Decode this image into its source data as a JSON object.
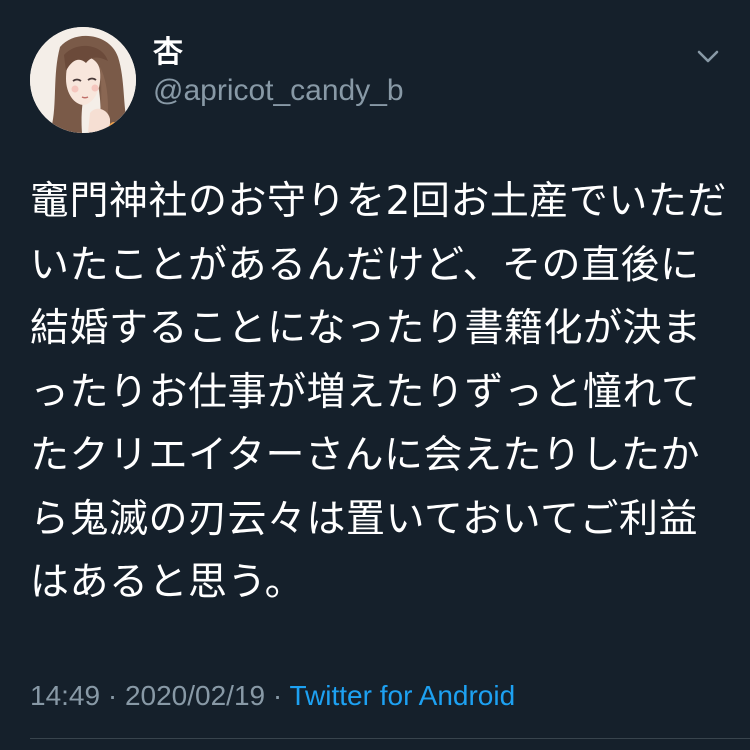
{
  "user": {
    "display_name": "杏",
    "handle": "@apricot_candy_b"
  },
  "tweet": {
    "text": "竈門神社のお守りを2回お土産でいただいたことがあるんだけど、その直後に結婚することになったり書籍化が決まったりお仕事が増えたりずっと憧れてたクリエイターさんに会えたりしたから鬼滅の刃云々は置いておいてご利益はあると思う。",
    "time": "14:49",
    "separator": "·",
    "date": "2020/02/19",
    "source": "Twitter for Android"
  },
  "icons": {
    "menu": "chevron-down-icon",
    "avatar": "profile-avatar"
  },
  "colors": {
    "background": "#15202b",
    "text": "#ffffff",
    "secondary": "#8899a6",
    "accent": "#1da1f2"
  }
}
